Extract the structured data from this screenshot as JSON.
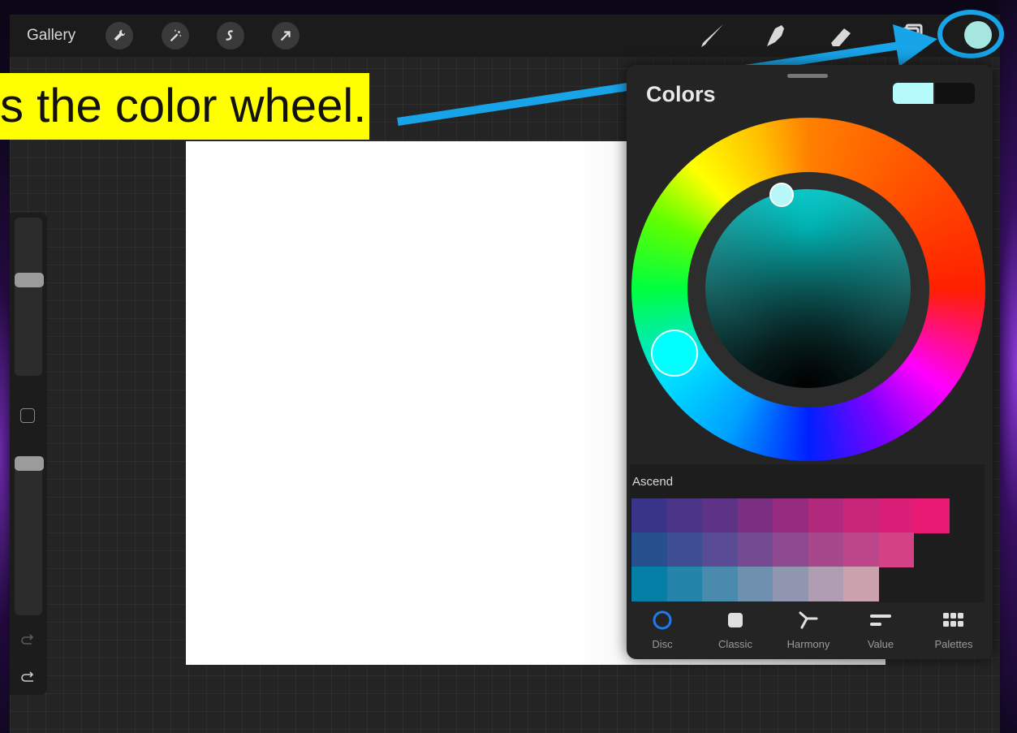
{
  "caption": "s the color wheel.",
  "topbar": {
    "gallery_label": "Gallery",
    "left_tools": [
      "wrench-icon",
      "magic-wand-icon",
      "selection-icon",
      "transform-arrow-icon"
    ],
    "right_tools": [
      "brush-icon",
      "smudge-icon",
      "eraser-icon",
      "layers-icon"
    ],
    "current_color": "#a5e6e0"
  },
  "colors_panel": {
    "title": "Colors",
    "primary_swatch": "#b6fbfc",
    "secondary_swatch": "#111111",
    "palette_name": "Ascend",
    "palette_rows": [
      [
        "#3a3588",
        "#4c3487",
        "#5e3386",
        "#7a2f83",
        "#962c80",
        "#b1297c",
        "#c9267a",
        "#db1f78",
        "#e81a74"
      ],
      [
        "#26508e",
        "#3f4d92",
        "#5a4b95",
        "#744a93",
        "#8e4a90",
        "#a7488c",
        "#bd4589",
        "#d54185"
      ],
      [
        "#047fa6",
        "#2584a9",
        "#4a8aac",
        "#6f90ae",
        "#9096b0",
        "#b19db2",
        "#cba1ad"
      ]
    ],
    "tabs": [
      {
        "label": "Disc",
        "icon": "disc-icon",
        "active": true
      },
      {
        "label": "Classic",
        "icon": "classic-square-icon",
        "active": false
      },
      {
        "label": "Harmony",
        "icon": "harmony-icon",
        "active": false
      },
      {
        "label": "Value",
        "icon": "value-sliders-icon",
        "active": false
      },
      {
        "label": "Palettes",
        "icon": "palettes-grid-icon",
        "active": false
      }
    ]
  },
  "accent": "#18a4e8"
}
